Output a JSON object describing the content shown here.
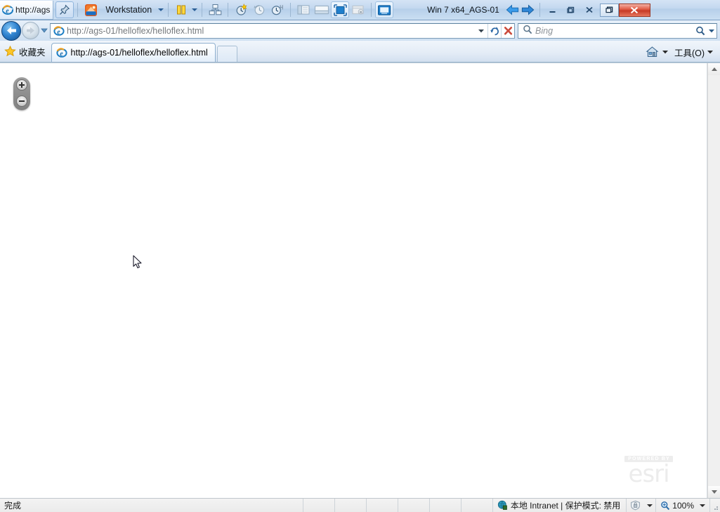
{
  "vmware": {
    "tab_label": "http://ags",
    "workstation_label": "Workstation",
    "vm_title": "Win 7 x64_AGS-01",
    "toolbar_icons": [
      "pin-icon",
      "vmware-logo-icon",
      "pause-icon",
      "pause-dropdown-caret-icon",
      "manage-vm-icon",
      "take-snapshot-icon",
      "revert-snapshot-icon",
      "snapshot-manager-icon",
      "show-library-icon",
      "show-thumbnail-bar-icon",
      "enter-fullscreen-icon",
      "unity-mode-icon",
      "console-view-icon"
    ],
    "nav_back_icon": "back-arrow-icon",
    "nav_forward_icon": "forward-arrow-icon",
    "window_buttons": {
      "minimize": "–",
      "restore": "❐",
      "close_x": "✕",
      "minimize_outer": "–",
      "maximize_outer": "❐",
      "close_outer": "✕"
    }
  },
  "browser": {
    "address": {
      "url": "http://ags-01/helloflex/helloflex.html",
      "icon": "ie-page-icon",
      "dropdown_icon": "chevron-down-icon",
      "refresh_icon": "refresh-icon",
      "stop_icon": "stop-icon"
    },
    "search": {
      "placeholder": "Bing",
      "icon": "search-icon",
      "dropdown_icon": "chevron-down-icon"
    },
    "favorites_label": "收藏夹",
    "favorites_icon": "star-icon",
    "tab": {
      "title": "http://ags-01/helloflex/helloflex.html",
      "icon": "ie-page-icon"
    },
    "new_tab_label": "",
    "home_icon": "home-icon",
    "home_caret_icon": "chevron-down-icon",
    "tools_label": "工具(O)",
    "tools_caret_icon": "chevron-down-icon"
  },
  "page_content": {
    "map": {
      "zoom_in_label": "+",
      "zoom_out_label": "−",
      "zoom_in_icon": "zoom-in-icon",
      "zoom_out_icon": "zoom-out-icon"
    },
    "esri_logo": {
      "powered_by": "POWERED BY",
      "wordmark": "esri"
    },
    "cursor_icon": "arrow-cursor-icon"
  },
  "status_bar": {
    "message": "完成",
    "zone_icon": "globe-icon",
    "zone_text": "本地 Intranet | 保护模式: 禁用",
    "protected_mode_icon": "shield-icon",
    "protected_caret_icon": "chevron-down-icon",
    "zoom_icon": "zoom-magnifier-icon",
    "zoom_level": "100%",
    "zoom_caret_icon": "chevron-down-icon",
    "resize_grip_icon": "resize-grip-icon"
  },
  "colors": {
    "titlebar_top": "#d5e4f5",
    "titlebar_bottom": "#cadef2",
    "close_button_red": "#c63a26",
    "page_background": "#ffffff",
    "esri_gray": "#ececec",
    "zoom_control_gray": "#8f8f8f"
  }
}
